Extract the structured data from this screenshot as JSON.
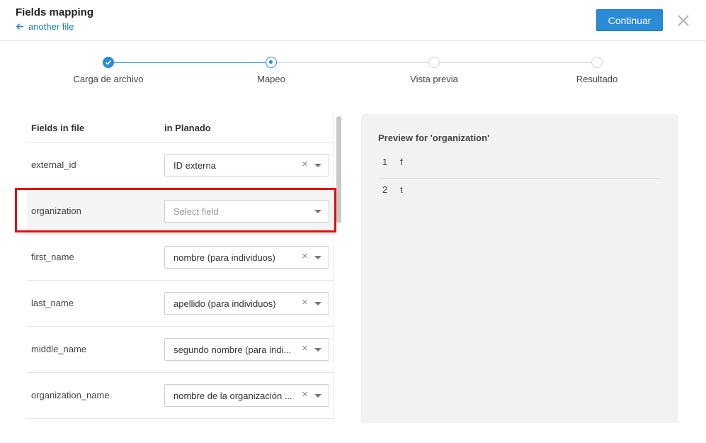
{
  "header": {
    "title": "Fields mapping",
    "back_label": "another file",
    "continue_label": "Continuar"
  },
  "steps": [
    {
      "label": "Carga de archivo",
      "state": "done"
    },
    {
      "label": "Mapeo",
      "state": "current"
    },
    {
      "label": "Vista previa",
      "state": "pending"
    },
    {
      "label": "Resultado",
      "state": "pending"
    }
  ],
  "mapping": {
    "col_file": "Fields in file",
    "col_target": "in Planado",
    "rows": [
      {
        "field": "external_id",
        "value": "ID externa",
        "placeholder": ""
      },
      {
        "field": "organization",
        "value": "",
        "placeholder": "Select field"
      },
      {
        "field": "first_name",
        "value": "nombre (para individuos)",
        "placeholder": ""
      },
      {
        "field": "last_name",
        "value": "apellido (para individuos)",
        "placeholder": ""
      },
      {
        "field": "middle_name",
        "value": "segundo nombre (para indi...",
        "placeholder": ""
      },
      {
        "field": "organization_name",
        "value": "nombre de la organización ...",
        "placeholder": ""
      }
    ]
  },
  "preview": {
    "title": "Preview for 'organization'",
    "rows": [
      {
        "index": "1",
        "value": "f"
      },
      {
        "index": "2",
        "value": "t"
      }
    ]
  },
  "colors": {
    "accent": "#2a8bd6",
    "highlight_border": "#e01010",
    "preview_bg": "#f2f2f2"
  }
}
